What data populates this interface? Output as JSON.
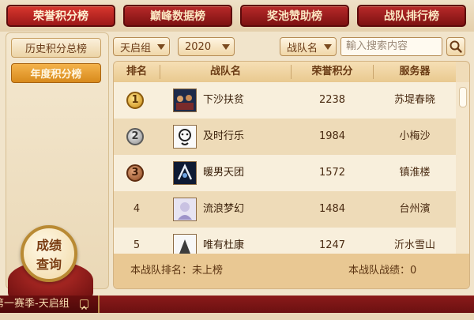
{
  "tabs": [
    {
      "label": "荣誉积分榜",
      "active": true
    },
    {
      "label": "巅峰数据榜",
      "active": false
    },
    {
      "label": "奖池赞助榜",
      "active": false
    },
    {
      "label": "战队排行榜",
      "active": false
    }
  ],
  "sidebar": {
    "items": [
      {
        "label": "历史积分总榜",
        "active": false
      },
      {
        "label": "年度积分榜",
        "active": true
      }
    ]
  },
  "filters": {
    "group": "天启组",
    "year": "2020",
    "search_type": "战队名",
    "search_placeholder": "輸入搜索内容"
  },
  "table": {
    "columns": [
      "排名",
      "战队名",
      "荣誉积分",
      "服务器"
    ],
    "rows": [
      {
        "rank": "1",
        "team": "下沙扶贫",
        "points": "2238",
        "server": "苏堤春晓"
      },
      {
        "rank": "2",
        "team": "及时行乐",
        "points": "1984",
        "server": "小梅沙"
      },
      {
        "rank": "3",
        "team": "暖男天团",
        "points": "1572",
        "server": "镇淮楼"
      },
      {
        "rank": "4",
        "team": "流浪梦幻",
        "points": "1484",
        "server": "台州濱"
      },
      {
        "rank": "5",
        "team": "唯有杜康",
        "points": "1247",
        "server": "沂水雪山"
      }
    ]
  },
  "footer": {
    "my_rank": "本战队排名：未上榜",
    "my_record": "本战队战绩：0"
  },
  "query_button": {
    "line1": "成绩",
    "line2": "查询"
  },
  "season": "第一赛季-天启组",
  "colors": {
    "tab_red": "#b82a2a",
    "active_orange": "#e39a2a",
    "panel_tan": "#f0dcb8"
  }
}
